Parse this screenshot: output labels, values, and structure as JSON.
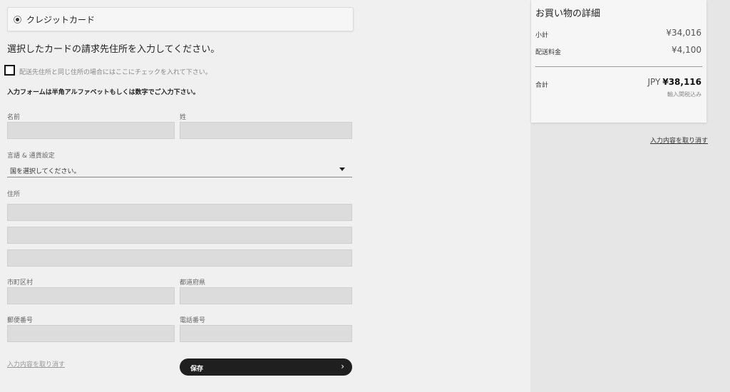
{
  "payment": {
    "option_label": "クレジットカード"
  },
  "billing": {
    "title": "選択したカードの請求先住所を入力してください。",
    "same_address_label": "配送先住所と同じ住所の場合にはここにチェックを入れて下さい。",
    "input_note": "入力フォームは半角アルファベットもしくは数字でご入力下さい。"
  },
  "form": {
    "first_name_label": "名前",
    "last_name_label": "姓",
    "language_currency_label": "言語 & 通貨設定",
    "country_select_value": "国を選択してください。",
    "address_label": "住所",
    "city_label": "市町区村",
    "prefecture_label": "都道府県",
    "postal_code_label": "郵便番号",
    "phone_label": "電話番号",
    "clear_link": "入力内容を取り消す",
    "save_label": "保存"
  },
  "summary": {
    "title": "お買い物の詳細",
    "subtotal_label": "小計",
    "subtotal_value": "¥34,016",
    "shipping_label": "配送料金",
    "shipping_value": "¥4,100",
    "total_label": "合計",
    "total_currency": "JPY",
    "total_value": "¥38,116",
    "tax_note": "輸入関税込み",
    "clear_link": "入力内容を取り消す"
  }
}
